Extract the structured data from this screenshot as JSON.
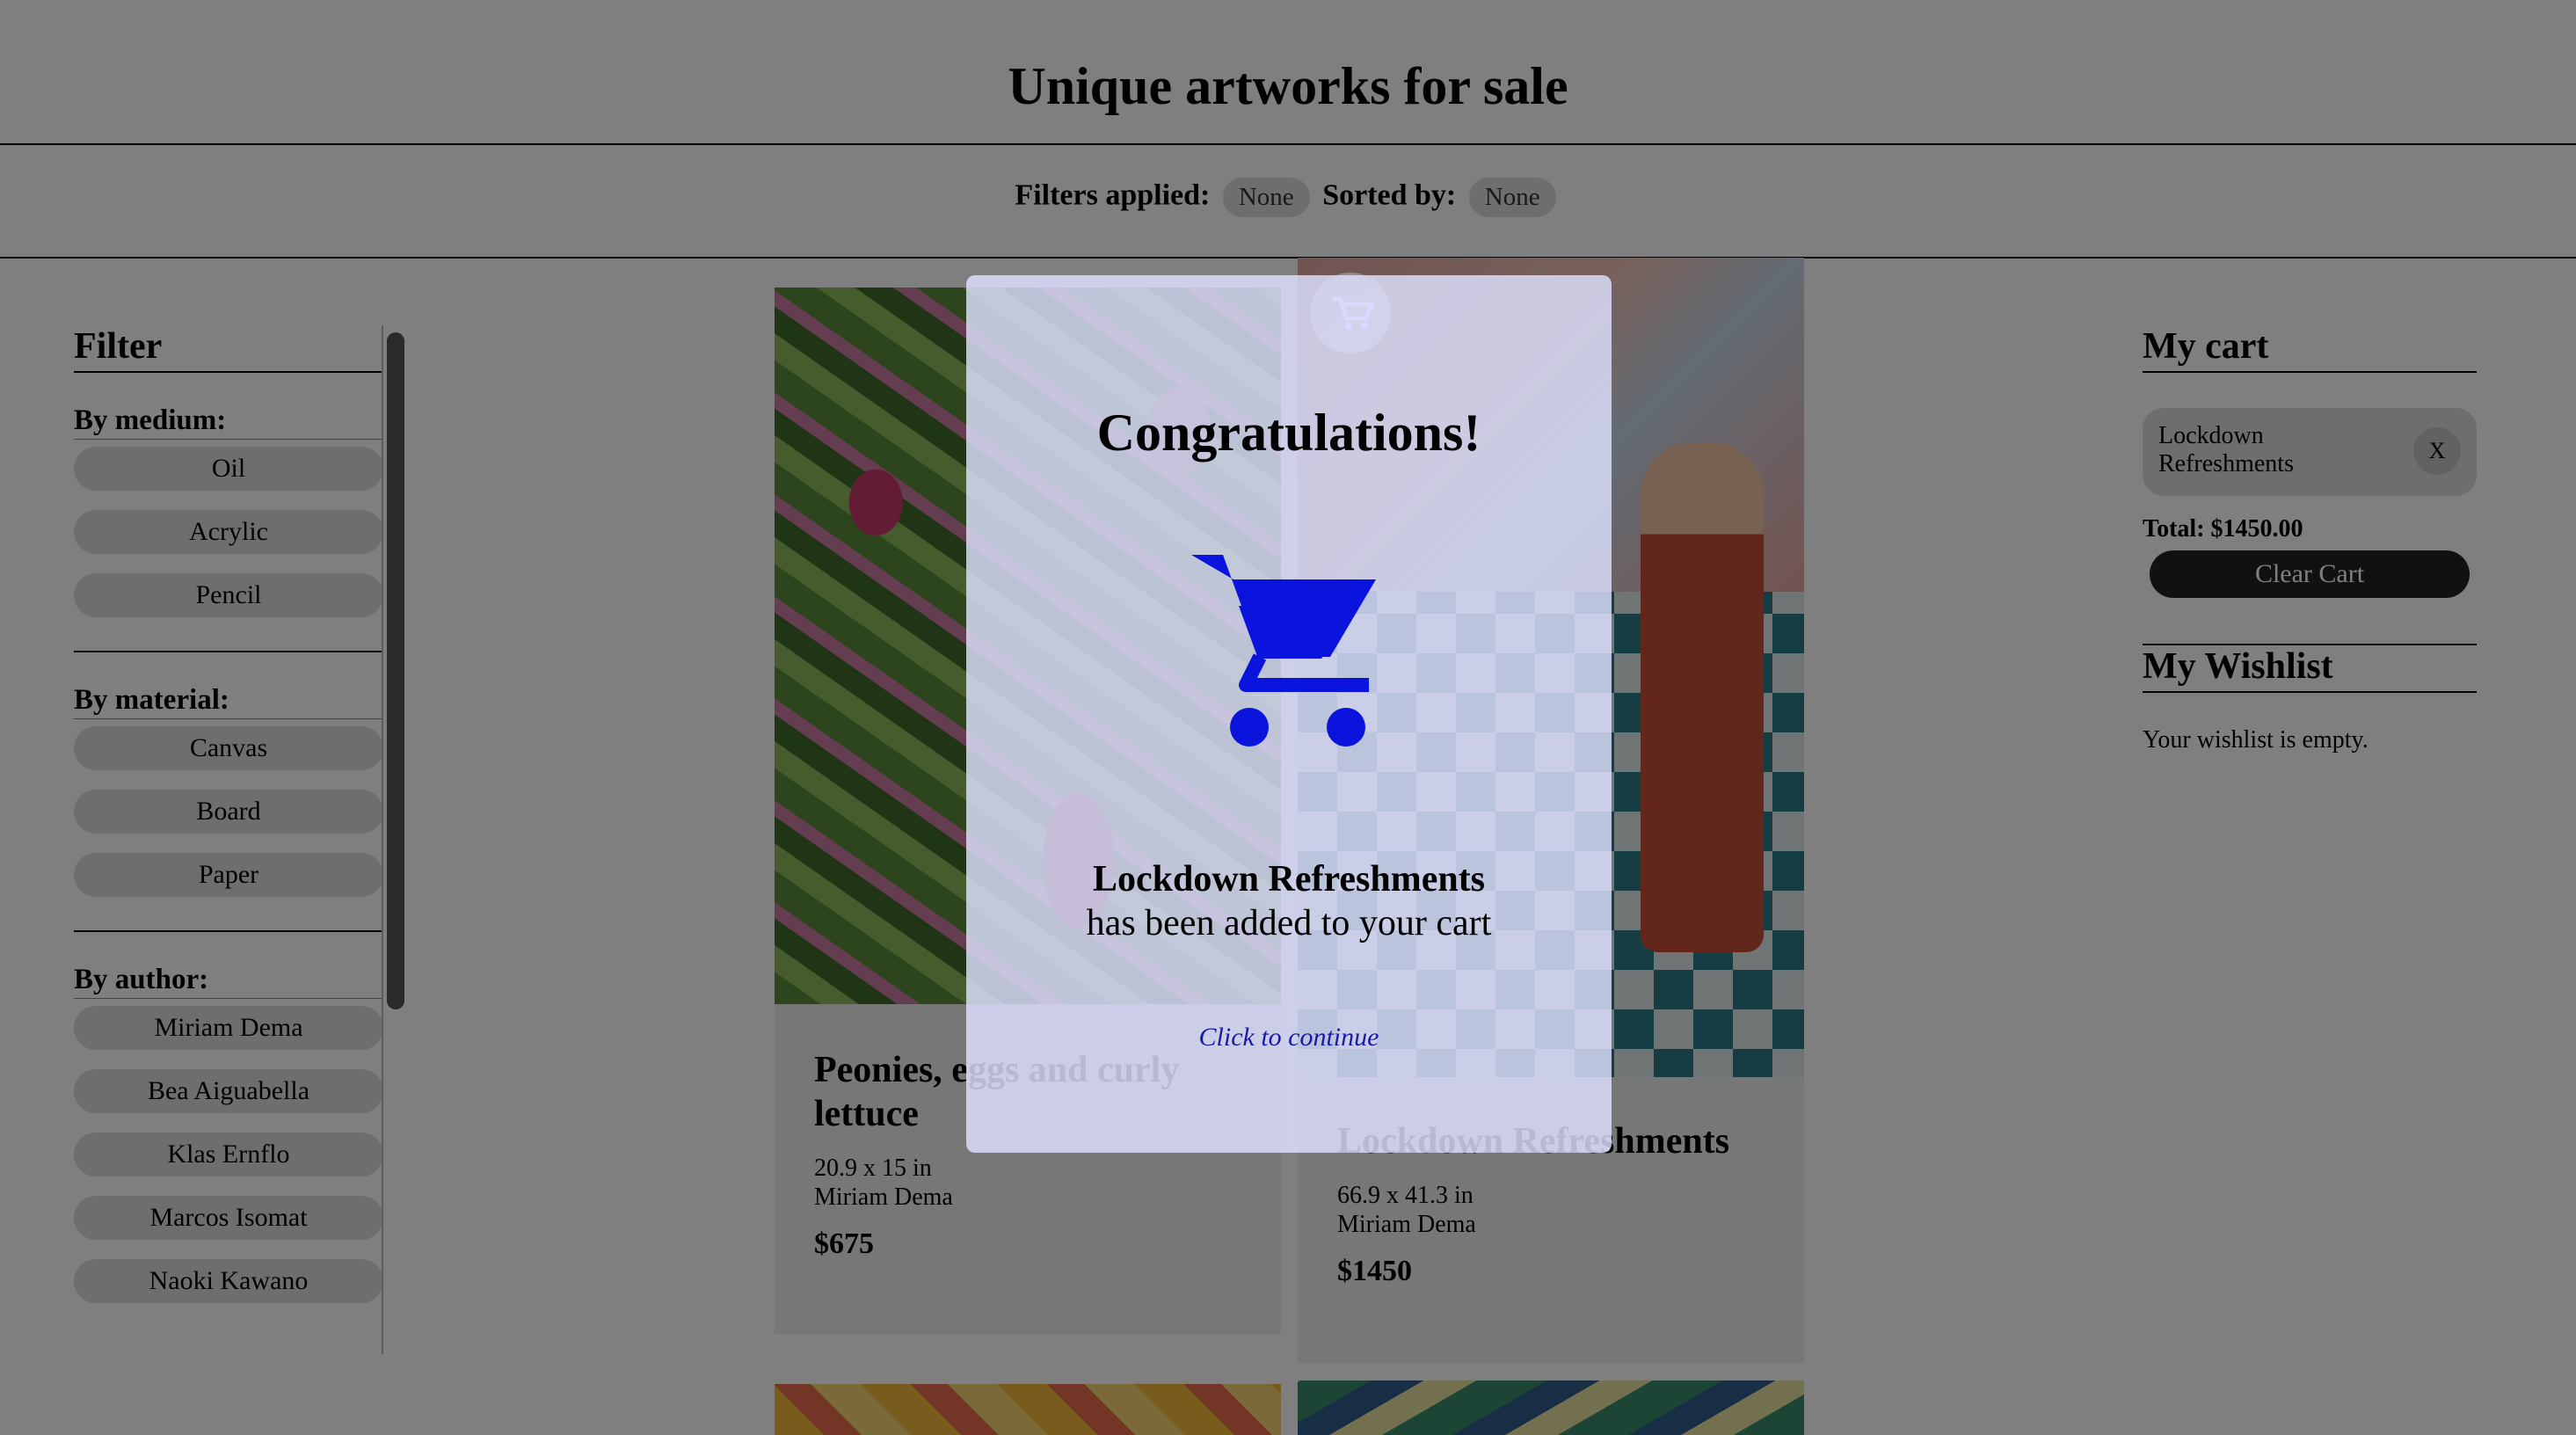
{
  "page": {
    "title": "Unique artworks for sale"
  },
  "filterbar": {
    "filters_label": "Filters applied:",
    "filters_value": "None",
    "sorted_label": "Sorted by:",
    "sorted_value": "None"
  },
  "sidebar": {
    "heading": "Filter",
    "groups": [
      {
        "label": "By medium:",
        "items": [
          "Oil",
          "Acrylic",
          "Pencil"
        ]
      },
      {
        "label": "By material:",
        "items": [
          "Canvas",
          "Board",
          "Paper"
        ]
      },
      {
        "label": "By author:",
        "items": [
          "Miriam Dema",
          "Bea Aiguabella",
          "Klas Ernflo",
          "Marcos Isomat",
          "Naoki Kawano"
        ]
      }
    ]
  },
  "products": [
    {
      "name": "Peonies, eggs and curly lettuce",
      "size": "20.9 x 15 in",
      "author": "Miriam Dema",
      "price": "$675"
    },
    {
      "name": "Lockdown Refreshments",
      "size": "66.9 x 41.3 in",
      "author": "Miriam Dema",
      "price": "$1450"
    }
  ],
  "cart": {
    "heading": "My cart",
    "items": [
      {
        "name": "Lockdown Refreshments",
        "remove_label": "X"
      }
    ],
    "total": "Total: $1450.00",
    "clear_label": "Clear Cart"
  },
  "wishlist": {
    "heading": "My Wishlist",
    "empty_text": "Your wishlist is empty."
  },
  "modal": {
    "title": "Congratulations!",
    "item_name": "Lockdown Refreshments",
    "message_suffix": " has been added to your cart",
    "continue_label": "Click to continue",
    "icon": "shopping-cart-icon",
    "icon_color": "#0000e6"
  }
}
